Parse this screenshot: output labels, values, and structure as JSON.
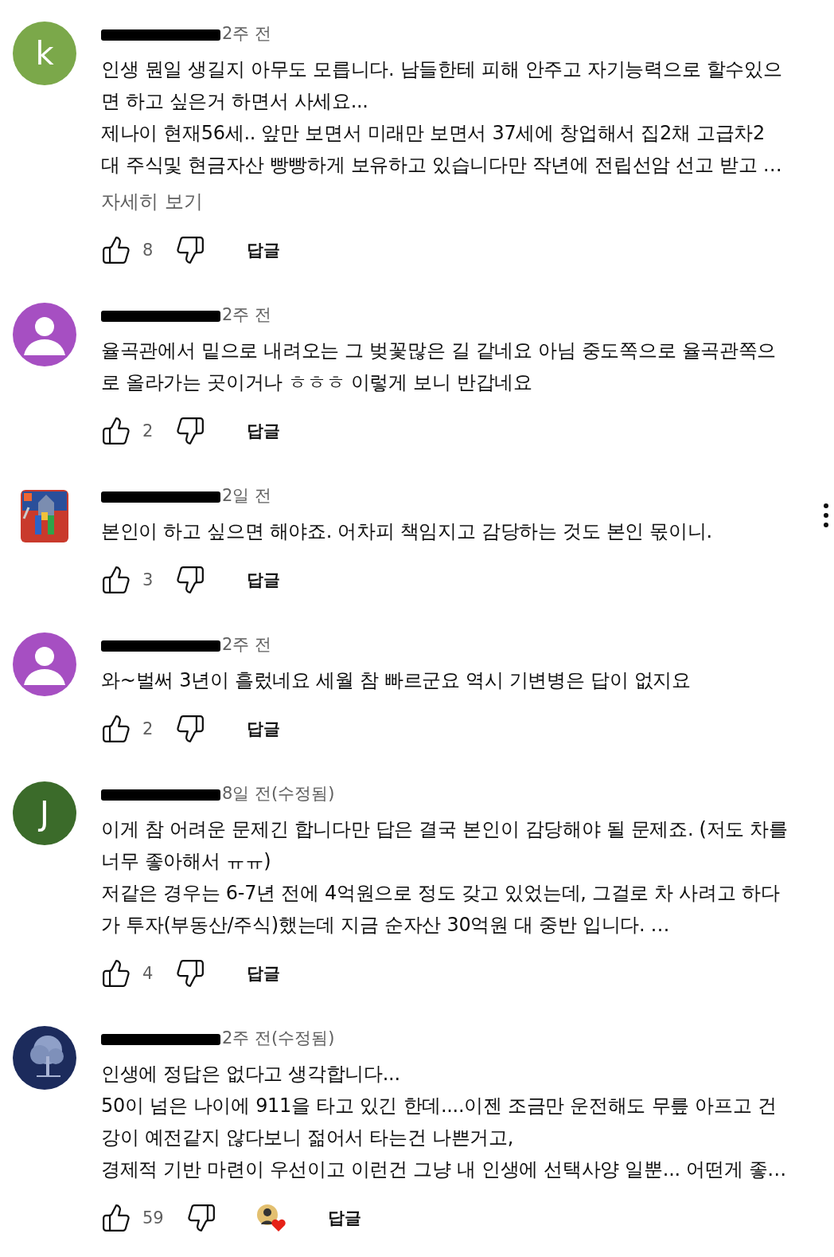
{
  "comments": [
    {
      "avatar": {
        "kind": "letter",
        "letter": "k",
        "color": "#7ba84a"
      },
      "time": "2주 전",
      "lines": [
        "인생 뭔일 생길지 아무도 모릅니다. 남들한테 피해 안주고 자기능력으로 할수있으",
        "면 하고 싶은거 하면서 사세요...",
        "제나이 현재56세..  앞만 보면서 미래만 보면서 37세에 창업해서 집2채 고급차2",
        "대 주식및 현금자산 빵빵하게 보유하고 있습니다만 작년에 전립선암 선고 받고 …"
      ],
      "read_more": "자세히 보기",
      "likes": "8",
      "reply": "답글"
    },
    {
      "avatar": {
        "kind": "default",
        "color": "#a64fc2"
      },
      "time": "2주 전",
      "lines": [
        "율곡관에서 밑으로 내려오는 그 벚꽃많은 길 같네요 아님 중도쪽으로 율곡관쪽으",
        "로 올라가는 곳이거나 ㅎㅎㅎ 이렇게 보니 반갑네요"
      ],
      "likes": "2",
      "reply": "답글"
    },
    {
      "avatar": {
        "kind": "picture"
      },
      "time": "2일 전",
      "lines": [
        "본인이 하고 싶으면 해야죠. 어차피 책임지고 감당하는 것도 본인 몫이니."
      ],
      "likes": "3",
      "reply": "답글",
      "menu": true
    },
    {
      "avatar": {
        "kind": "default",
        "color": "#a64fc2"
      },
      "time": "2주 전",
      "lines": [
        "와~벌써 3년이 흘렀네요  세월 참 빠르군요 역시 기변병은 답이 없지요"
      ],
      "likes": "2",
      "reply": "답글"
    },
    {
      "avatar": {
        "kind": "letter",
        "letter": "J",
        "color": "#3b6b2a"
      },
      "time": "8일 전(수정됨)",
      "lines": [
        "이게 참 어려운 문제긴 합니다만 답은 결국 본인이 감당해야 될 문제죠. (저도 차를",
        "너무 좋아해서 ㅠㅠ)",
        "저같은 경우는 6-7년 전에 4억원으로 정도 갖고 있었는데, 그걸로 차 사려고 하다",
        "가 투자(부동산/주식)했는데 지금 순자산 30억원 대 중반 입니다. …"
      ],
      "likes": "4",
      "reply": "답글"
    },
    {
      "avatar": {
        "kind": "picture"
      },
      "time": "2주 전(수정됨)",
      "lines": [
        "인생에 정답은 없다고 생각합니다...",
        "50이 넘은 나이에 911을 타고 있긴 한데....이젠 조금만 운전해도 무릎 아프고 건",
        "강이 예전같지 않다보니 젊어서 타는건 나쁜거고,",
        "경제적 기반 마련이 우선이고 이런건 그냥 내 인생에 선택사양 일뿐... 어떤게 좋…"
      ],
      "likes": "59",
      "reply": "답글",
      "creator_heart": true
    }
  ]
}
